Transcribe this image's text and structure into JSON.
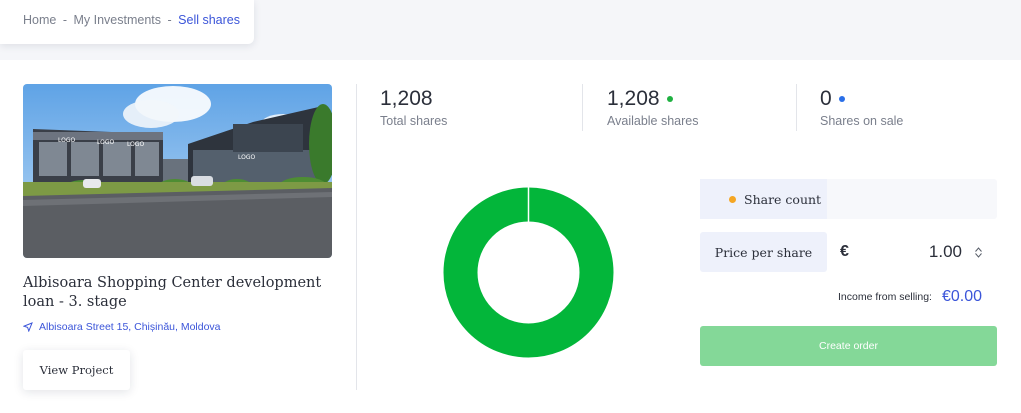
{
  "breadcrumb": {
    "items": [
      "Home",
      "My Investments"
    ],
    "separator": "-",
    "current": "Sell shares"
  },
  "project": {
    "title": "Albisoara Shopping Center development loan - 3. stage",
    "location": "Albisoara Street 15, Chișinău, Moldova",
    "view_button": "View Project",
    "image_sign_text": "LOGO"
  },
  "stats": [
    {
      "value": "1,208",
      "label": "Total shares",
      "dot_color": ""
    },
    {
      "value": "1,208",
      "label": "Available shares",
      "dot_color": "#1fb141"
    },
    {
      "value": "0",
      "label": "Shares on sale",
      "dot_color": "#2a6fe8"
    }
  ],
  "donut": {
    "available_shares": 1208,
    "shares_on_sale": 0,
    "color": "#03b63a"
  },
  "form": {
    "share_count_label": "Share count",
    "share_count_value": "",
    "price_label": "Price per share",
    "currency": "€",
    "price_value": "1.00",
    "income_label": "Income from selling:",
    "income_value": "€0.00",
    "create_button": "Create order"
  },
  "colors": {
    "accent": "#3b55d9",
    "donut_green": "#03b63a",
    "button_green_disabled": "#84d898",
    "share_count_dot": "#f5a623"
  }
}
